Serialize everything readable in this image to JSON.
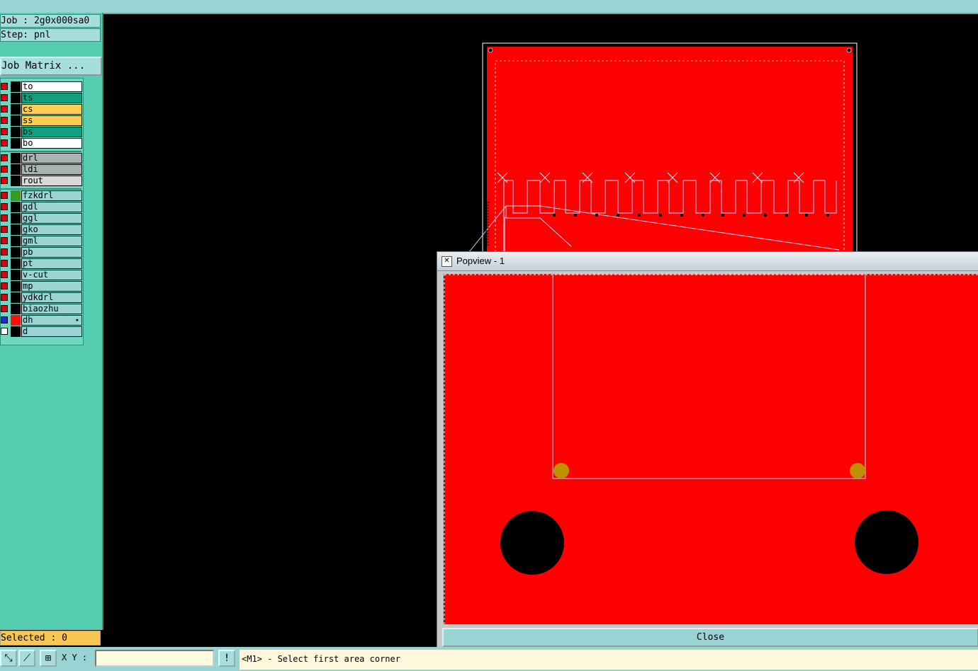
{
  "header": {
    "job_line": "Job : 2g0x000sa0",
    "step_line": "Step: pnl",
    "job_matrix_label": "Job Matrix ..."
  },
  "layers": [
    {
      "name": "to",
      "color": "#ffffff"
    },
    {
      "name": "ts",
      "color": "#10a080"
    },
    {
      "name": "cs",
      "color": "#ffcc55"
    },
    {
      "name": "ss",
      "color": "#ffcc55"
    },
    {
      "name": "bs",
      "color": "#10a080"
    },
    {
      "name": "bo",
      "color": "#ffffff"
    },
    {
      "name": "drl",
      "color": "#a8b4b4"
    },
    {
      "name": "ldi",
      "color": "#a8b4b4"
    },
    {
      "name": "rout",
      "color": "#d8d8d8"
    },
    {
      "name": "fzkdrl",
      "color": "#9ad3d3"
    },
    {
      "name": "gdl",
      "color": "#9ad3d3"
    },
    {
      "name": "ggl",
      "color": "#9ad3d3"
    },
    {
      "name": "gko",
      "color": "#9ad3d3"
    },
    {
      "name": "gml",
      "color": "#9ad3d3"
    },
    {
      "name": "pb",
      "color": "#9ad3d3"
    },
    {
      "name": "pt",
      "color": "#9ad3d3"
    },
    {
      "name": "v-cut",
      "color": "#9ad3d3"
    },
    {
      "name": "mp",
      "color": "#9ad3d3"
    },
    {
      "name": "ydkdrl",
      "color": "#9ad3d3"
    },
    {
      "name": "biaozhu",
      "color": "#9ad3d3"
    },
    {
      "name": "dh",
      "color": "#9ad3d3"
    },
    {
      "name": "d",
      "color": "#9ad3d3"
    }
  ],
  "selected_text": "Selected : 0",
  "bottom": {
    "xy_label": "X Y :",
    "xy_value": "",
    "status": "<M1> - Select first area corner",
    "warn_icon": "!"
  },
  "popup": {
    "title": "Popview - 1",
    "close_label": "Close"
  },
  "colors": {
    "copper": "#ff0000",
    "panel": "#54cdb0",
    "selected_bg": "#f7c654",
    "pad": "#c09000"
  },
  "icons": [
    "zoom-icon",
    "measure-icon",
    "grid-icon",
    "warning-icon",
    "close-x-icon"
  ]
}
